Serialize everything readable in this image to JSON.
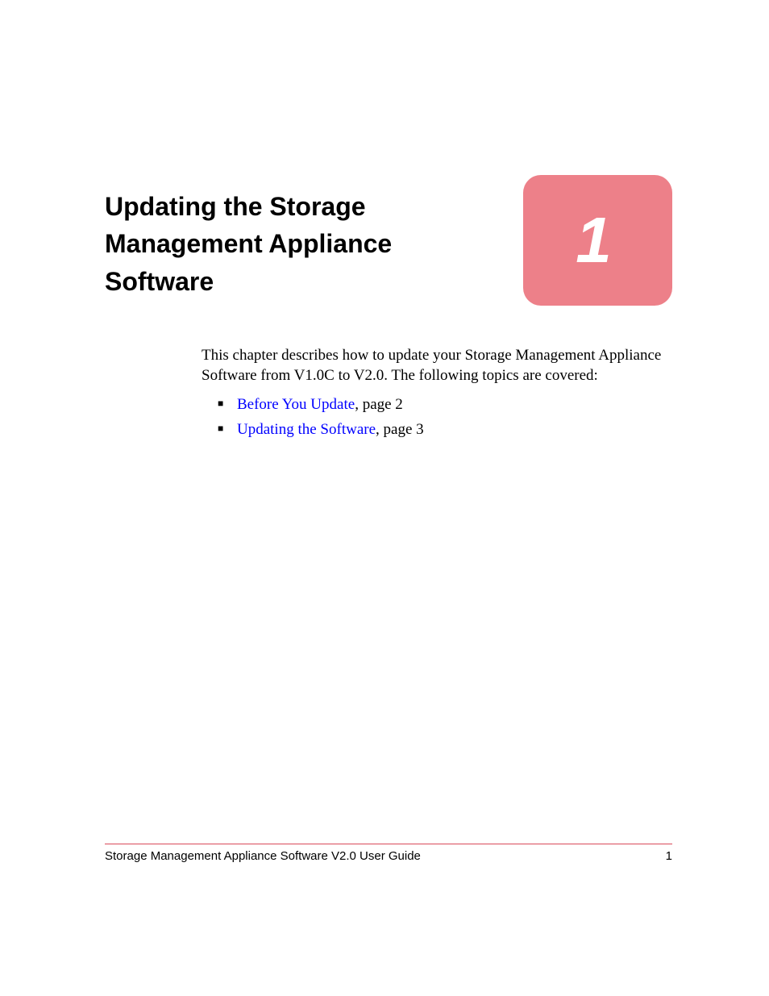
{
  "chapter": {
    "title": "Updating the Storage Management Appliance Software",
    "number": "1"
  },
  "intro": "This chapter describes how to update your Storage Management Appliance Software from V1.0C to V2.0. The following topics are covered:",
  "bullets": [
    {
      "link_text": "Before You Update",
      "suffix": ", page 2"
    },
    {
      "link_text": "Updating the Software",
      "suffix": ", page 3"
    }
  ],
  "footer": {
    "doc_title": "Storage Management Appliance Software V2.0 User Guide",
    "page_number": "1"
  }
}
